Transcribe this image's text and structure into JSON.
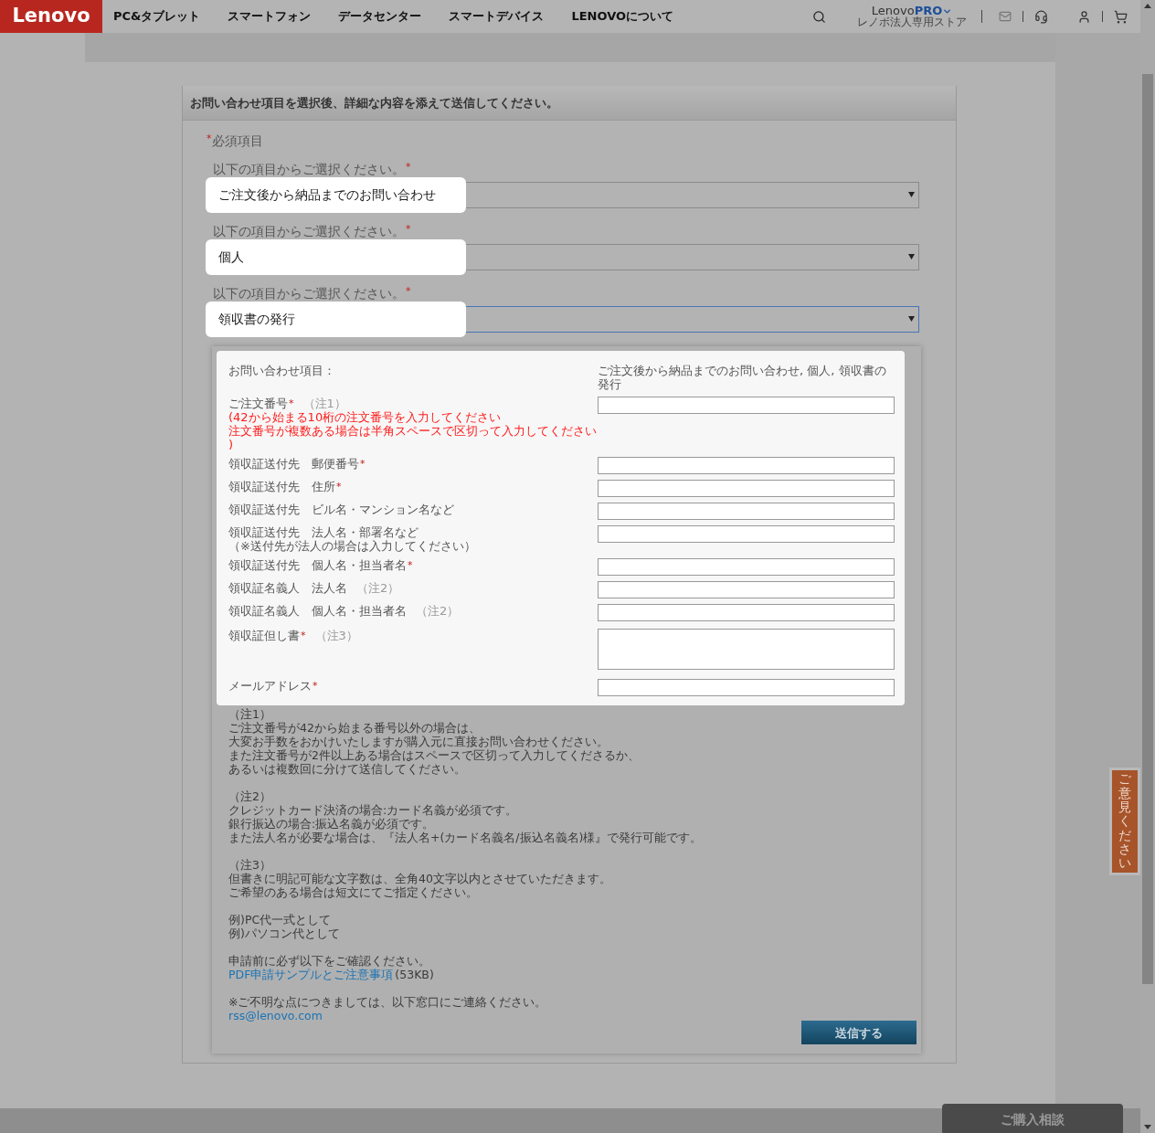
{
  "header": {
    "logo": "Lenovo",
    "nav": [
      {
        "label": "PC&タブレット"
      },
      {
        "label": "スマートフォン"
      },
      {
        "label": "データセンター"
      },
      {
        "label": "スマートデバイス"
      },
      {
        "label": "LENOVOについて"
      }
    ],
    "pro_brand": {
      "name": "Lenovo",
      "suffix": "PRO",
      "subtitle": "レノボ法人専用ストア"
    }
  },
  "required_mark": "*",
  "form": {
    "title": "お問い合わせ項目を選択後、詳細な内容を添えて送信してください。",
    "required_note": "必須項目",
    "selects": [
      {
        "label": "以下の項目からご選択ください。",
        "value": "ご注文後から納品までのお問い合わせ",
        "focused": false
      },
      {
        "label": "以下の項目からご選択ください。",
        "value": "個人",
        "focused": false
      },
      {
        "label": "以下の項目からご選択ください。",
        "value": "領収書の発行",
        "focused": true
      }
    ],
    "summary": {
      "label": "お問い合わせ項目：",
      "value": "ご注文後から納品までのお問い合わせ, 個人, 領収書の発行"
    },
    "fields": [
      {
        "kind": "input",
        "label": "ご注文番号",
        "required": true,
        "note": "（注1）",
        "hints": [
          "(42から始まる10桁の注文番号を入力してください",
          "注文番号が複数ある場合は半角スペースで区切って入力してください",
          ")"
        ]
      },
      {
        "kind": "input",
        "label": "領収証送付先　郵便番号",
        "required": true
      },
      {
        "kind": "input",
        "label": "領収証送付先　住所",
        "required": true
      },
      {
        "kind": "input",
        "label": "領収証送付先　ビル名・マンション名など",
        "required": false
      },
      {
        "kind": "input",
        "label": "領収証送付先　法人名・部署名など",
        "required": false,
        "sublabel": "（※送付先が法人の場合は入力してください）"
      },
      {
        "kind": "input",
        "label": "領収証送付先　個人名・担当者名",
        "required": true
      },
      {
        "kind": "input",
        "label": "領収証名義人　法人名",
        "required": false,
        "note": "（注2）"
      },
      {
        "kind": "input",
        "label": "領収証名義人　個人名・担当者名",
        "required": false,
        "note": "（注2）"
      },
      {
        "kind": "textarea",
        "label": "領収証但し書",
        "required": true,
        "note": "（注3）"
      },
      {
        "kind": "input",
        "label": "メールアドレス",
        "required": true
      }
    ],
    "notes": [
      [
        "（注1）",
        "ご注文番号が42から始まる番号以外の場合は、",
        "大変お手数をおかけいたしますが購入元に直接お問い合わせください。",
        "また注文番号が2件以上ある場合はスペースで区切って入力してくださるか、",
        "あるいは複数回に分けて送信してください。"
      ],
      [
        "（注2）",
        "クレジットカード決済の場合:カード名義が必須です。",
        "銀行振込の場合:振込名義が必須です。",
        "また法人名が必要な場合は、『法人名+(カード名義名/振込名義名)様』で発行可能です。"
      ],
      [
        "（注3）",
        "但書きに明記可能な文字数は、全角40文字以内とさせていただきます。",
        "ご希望のある場合は短文にてご指定ください。"
      ],
      [
        "例)PC代一式として",
        "例)パソコン代として"
      ]
    ],
    "confirm": {
      "text": "申請前に必ず以下をご確認ください。",
      "link": "PDF申請サンプルとご注意事項",
      "size": "(53KB)"
    },
    "contact": {
      "text": "※ご不明な点につきましては、以下窓口にご連絡ください。",
      "email": "rss@lenovo.com"
    },
    "submit": "送信する"
  },
  "feedback_tab": "ご意見ください",
  "consult_button": "ご購入相談"
}
